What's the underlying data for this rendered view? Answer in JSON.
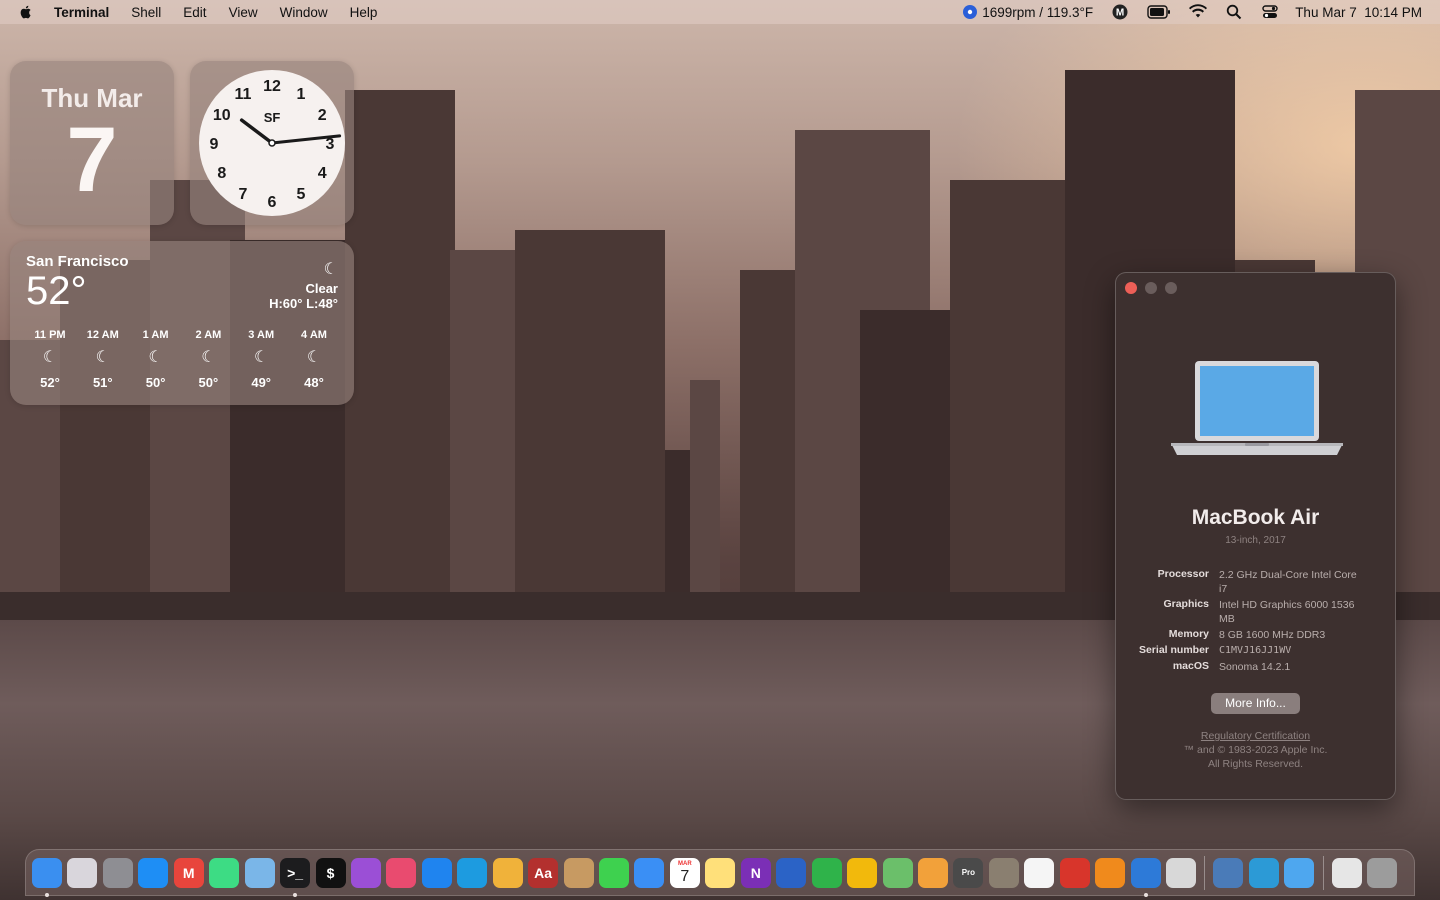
{
  "menubar": {
    "app": "Terminal",
    "items": [
      "Shell",
      "Edit",
      "View",
      "Window",
      "Help"
    ],
    "status_text": "1699rpm / 119.3°F",
    "datetime": "Thu Mar 7  10:14 PM"
  },
  "date_widget": {
    "weekday_month": "Thu Mar",
    "day": "7"
  },
  "clock_widget": {
    "city": "SF",
    "numbers": [
      "12",
      "1",
      "2",
      "3",
      "4",
      "5",
      "6",
      "7",
      "8",
      "9",
      "10",
      "11"
    ],
    "hour": 10,
    "minute": 14
  },
  "weather": {
    "city": "San Francisco",
    "temp": "52°",
    "condition": "Clear",
    "hilo": "H:60° L:48°",
    "hours": [
      {
        "time": "11 PM",
        "temp": "52°"
      },
      {
        "time": "12 AM",
        "temp": "51°"
      },
      {
        "time": "1 AM",
        "temp": "50°"
      },
      {
        "time": "2 AM",
        "temp": "50°"
      },
      {
        "time": "3 AM",
        "temp": "49°"
      },
      {
        "time": "4 AM",
        "temp": "48°"
      }
    ]
  },
  "about": {
    "model": "MacBook Air",
    "subtitle": "13-inch, 2017",
    "specs": [
      {
        "k": "Processor",
        "v": "2.2 GHz Dual-Core Intel Core i7"
      },
      {
        "k": "Graphics",
        "v": "Intel HD Graphics 6000 1536 MB"
      },
      {
        "k": "Memory",
        "v": "8 GB 1600 MHz DDR3"
      },
      {
        "k": "Serial number",
        "v": "C1MVJ16JJ1WV"
      },
      {
        "k": "macOS",
        "v": "Sonoma 14.2.1"
      }
    ],
    "more_info": "More Info...",
    "regulatory": "Regulatory Certification",
    "copyright": "™ and © 1983-2023 Apple Inc.",
    "rights": "All Rights Reserved."
  },
  "dock": {
    "calendar_month": "MAR",
    "calendar_day": "7",
    "items": [
      {
        "name": "finder",
        "color": "#3a8ff0",
        "running": true
      },
      {
        "name": "launchpad",
        "color": "#d9d6dc"
      },
      {
        "name": "system-settings",
        "color": "#8e8e93"
      },
      {
        "name": "app-store",
        "color": "#1e8ef5"
      },
      {
        "name": "gmail",
        "color": "#e8453c",
        "label": "M"
      },
      {
        "name": "android-studio",
        "color": "#3ddc84"
      },
      {
        "name": "preview",
        "color": "#7ab6e8"
      },
      {
        "name": "terminal",
        "color": "#1c1c1e",
        "label": ">_",
        "running": true
      },
      {
        "name": "iterm",
        "color": "#111",
        "label": "$"
      },
      {
        "name": "podcasts",
        "color": "#9b4fd6"
      },
      {
        "name": "bot-app",
        "color": "#e94b6f"
      },
      {
        "name": "safari",
        "color": "#1f84ef"
      },
      {
        "name": "edge",
        "color": "#1d9be0"
      },
      {
        "name": "chrome",
        "color": "#f0b23a"
      },
      {
        "name": "dictionary",
        "color": "#b3302e",
        "label": "Aa"
      },
      {
        "name": "contacts",
        "color": "#c79a62"
      },
      {
        "name": "messages",
        "color": "#3ed14f"
      },
      {
        "name": "mail",
        "color": "#3a8ff5"
      },
      {
        "name": "calendar",
        "color": "#ffffff"
      },
      {
        "name": "notes",
        "color": "#ffe07a"
      },
      {
        "name": "onenote",
        "color": "#7b2fb6",
        "label": "N"
      },
      {
        "name": "word",
        "color": "#2b63c6"
      },
      {
        "name": "numbers",
        "color": "#2fb34a"
      },
      {
        "name": "keynote",
        "color": "#f2b90c"
      },
      {
        "name": "maps",
        "color": "#6bbf6a"
      },
      {
        "name": "photos",
        "color": "#f2a13a"
      },
      {
        "name": "final-cut-pro",
        "color": "#4a4a4a",
        "label": "Pro"
      },
      {
        "name": "gimp",
        "color": "#8a7f70"
      },
      {
        "name": "reminders",
        "color": "#f5f5f5"
      },
      {
        "name": "strawberry",
        "color": "#d8352b"
      },
      {
        "name": "vlc",
        "color": "#f08a1c"
      },
      {
        "name": "xcode-tool",
        "color": "#2d7ad8",
        "running": true
      },
      {
        "name": "utility",
        "color": "#d8d8d8"
      },
      {
        "name": "sep1",
        "sep": true
      },
      {
        "name": "screen-sharing",
        "color": "#4a7bb8"
      },
      {
        "name": "activity",
        "color": "#2c9ad6"
      },
      {
        "name": "icloud",
        "color": "#4ea7ef"
      },
      {
        "name": "sep2",
        "sep": true
      },
      {
        "name": "downloads",
        "color": "#e6e6e6"
      },
      {
        "name": "trash",
        "color": "#9c9c9c"
      }
    ]
  }
}
